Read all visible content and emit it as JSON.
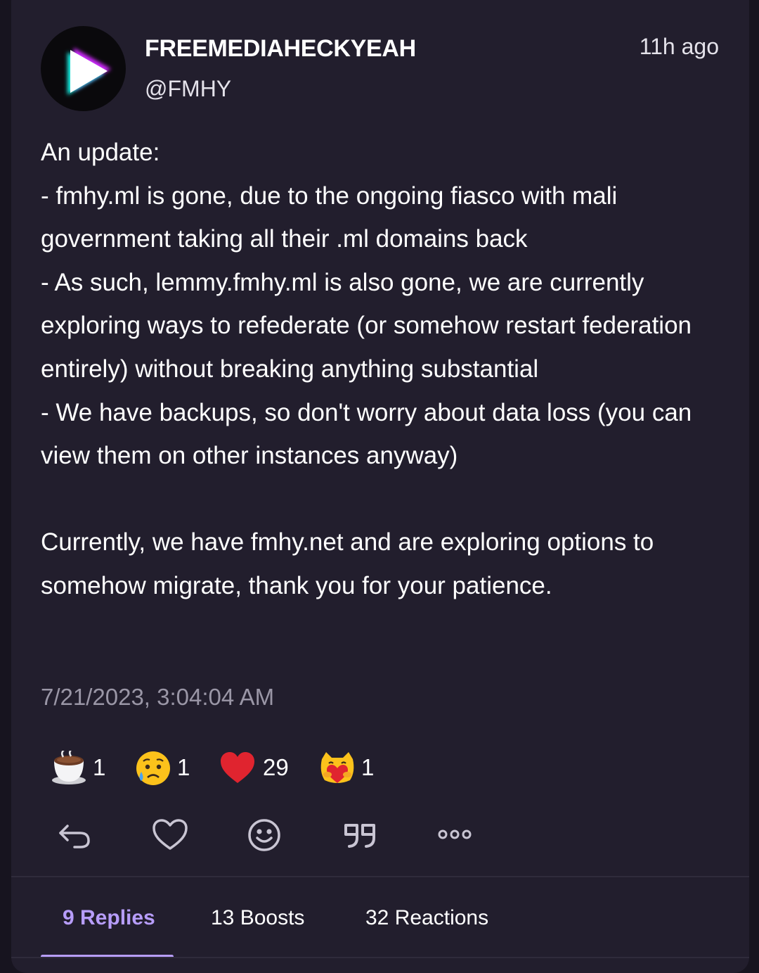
{
  "post": {
    "display_name": "FREEMEDIAHECKYEAH",
    "handle": "@FMHY",
    "time_ago": "11h ago",
    "avatar_icon": "play-icon",
    "content": [
      "An update:\n- fmhy.ml is gone, due to the ongoing fiasco with mali government taking all their .ml domains back\n- As such, lemmy.fmhy.ml is also gone, we are currently exploring ways to refederate (or somehow restart federation entirely) without breaking anything substantial\n- We have backups, so don't worry about data loss (you can view them on other instances anyway)",
      "Currently, we have fmhy.net and are exploring options to somehow migrate, thank you for your patience."
    ],
    "timestamp": "7/21/2023, 3:04:04 AM"
  },
  "reactions": [
    {
      "icon": "coffee-icon",
      "count": "1"
    },
    {
      "icon": "sad-sweat-face-icon",
      "count": "1"
    },
    {
      "icon": "heart-icon",
      "count": "29"
    },
    {
      "icon": "cat-hugging-heart-icon",
      "count": "1"
    }
  ],
  "actions": [
    {
      "name": "reply-button",
      "icon": "reply-icon"
    },
    {
      "name": "favorite-button",
      "icon": "heart-outline-icon"
    },
    {
      "name": "react-button",
      "icon": "smiley-icon"
    },
    {
      "name": "quote-button",
      "icon": "quote-icon"
    },
    {
      "name": "more-button",
      "icon": "more-icon"
    }
  ],
  "tabs": [
    {
      "label": "9 Replies",
      "active": true
    },
    {
      "label": "13 Boosts",
      "active": false
    },
    {
      "label": "32 Reactions",
      "active": false
    }
  ],
  "colors": {
    "background": "#17141f",
    "card": "#221e2d",
    "accent": "#b79dfa",
    "muted_text": "#9a96a6"
  }
}
